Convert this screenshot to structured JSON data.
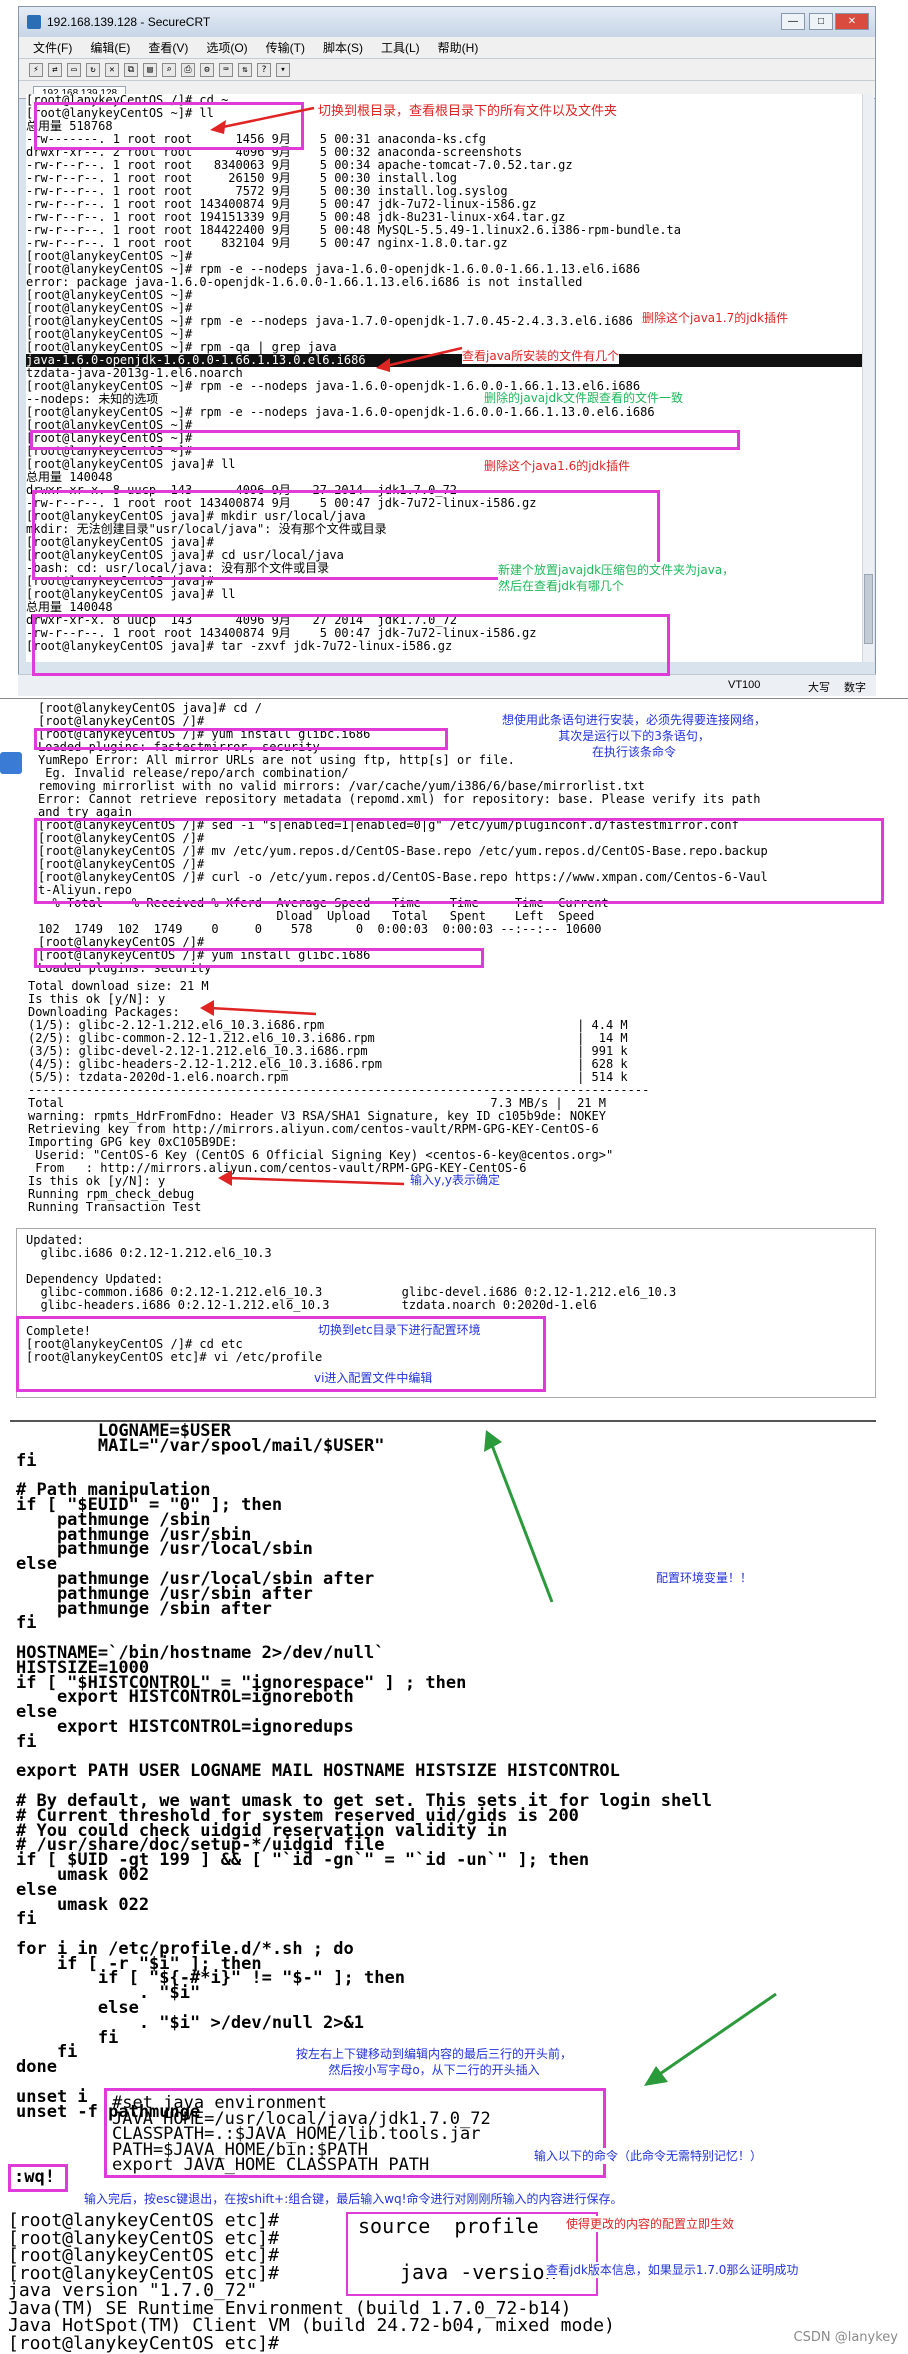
{
  "window": {
    "title": "192.168.139.128 - SecureCRT",
    "min": "—",
    "max": "□",
    "close": "✕",
    "tab": "192.168.139.128"
  },
  "menu": [
    "文件(F)",
    "编辑(E)",
    "查看(V)",
    "选项(O)",
    "传输(T)",
    "脚本(S)",
    "工具(L)",
    "帮助(H)"
  ],
  "status": {
    "proto": "VT100",
    "size": "大写",
    "caps": "数字"
  },
  "term1": [
    "[root@lanykeyCentOS /]# cd ~",
    "[root@lanykeyCentOS ~]# ll",
    "总用量 518768",
    "-rw-------. 1 root root      1456 9月    5 00:31 anaconda-ks.cfg",
    "drwxr-xr--. 2 root root      4096 9月    5 00:32 anaconda-screenshots",
    "-rw-r--r--. 1 root root   8340063 9月    5 00:34 apache-tomcat-7.0.52.tar.gz",
    "-rw-r--r--. 1 root root     26150 9月    5 00:30 install.log",
    "-rw-r--r--. 1 root root      7572 9月    5 00:30 install.log.syslog",
    "-rw-r--r--. 1 root root 143400874 9月    5 00:47 jdk-7u72-linux-i586.gz",
    "-rw-r--r--. 1 root root 194151339 9月    5 00:48 jdk-8u231-linux-x64.tar.gz",
    "-rw-r--r--. 1 root root 184422400 9月    5 00:48 MySQL-5.5.49-1.linux2.6.i386-rpm-bundle.ta",
    "-rw-r--r--. 1 root root    832104 9月    5 00:47 nginx-1.8.0.tar.gz",
    "[root@lanykeyCentOS ~]#",
    "[root@lanykeyCentOS ~]# rpm -e --nodeps java-1.6.0-openjdk-1.6.0.0-1.66.1.13.el6.i686",
    "error: package java-1.6.0-openjdk-1.6.0.0-1.66.1.13.el6.i686 is not installed",
    "[root@lanykeyCentOS ~]#",
    "[root@lanykeyCentOS ~]#",
    "[root@lanykeyCentOS ~]# rpm -e --nodeps java-1.7.0-openjdk-1.7.0.45-2.4.3.3.el6.i686",
    "[root@lanykeyCentOS ~]#",
    "[root@lanykeyCentOS ~]# rpm -qa | grep java",
    "java-1.6.0-openjdk-1.6.0.0-1.66.1.13.0.el6.i686",
    "tzdata-java-2013g-1.el6.noarch",
    "[root@lanykeyCentOS ~]# rpm -e --nodeps java-1.6.0-openjdk-1.6.0.0-1.66.1.13.el6.i686",
    "--nodeps: 未知的选项",
    "[root@lanykeyCentOS ~]# rpm -e --nodeps java-1.6.0-openjdk-1.6.0.0-1.66.1.13.0.el6.i686",
    "[root@lanykeyCentOS ~]#",
    "[root@lanykeyCentOS ~]#",
    "[root@lanykeyCentOS ~]#",
    "[root@lanykeyCentOS java]# ll",
    "总用量 140048",
    "drwxr-xr-x. 8 uucp  143      4096 9月   27 2014  jdk1.7.0_72",
    "-rw-r--r--. 1 root root 143400874 9月    5 00:47 jdk-7u72-linux-i586.gz",
    "[root@lanykeyCentOS java]# mkdir usr/local/java",
    "mkdir: 无法创建目录\"usr/local/java\": 没有那个文件或目录",
    "[root@lanykeyCentOS java]#",
    "[root@lanykeyCentOS java]# cd usr/local/java",
    "-bash: cd: usr/local/java: 没有那个文件或目录",
    "[root@lanykeyCentOS java]#",
    "[root@lanykeyCentOS java]# ll",
    "总用量 140048",
    "drwxr-xr-x. 8 uucp  143      4096 9月   27 2014  jdk1.7.0_72",
    "-rw-r--r--. 1 root root 143400874 9月    5 00:47 jdk-7u72-linux-i586.gz",
    "[root@lanykeyCentOS java]# tar -zxvf jdk-7u72-linux-i586.gz"
  ],
  "notes1": {
    "a": "切换到根目录，查看根目录下的所有文件以及文件夹",
    "b": "删除这个java1.7的jdk插件",
    "c": "查看java所安装的文件有几个",
    "d": "删除的javajdk文件跟查看的文件一致",
    "e": "删除这个java1.6的jdk插件",
    "f": "新建个放置javajdk压缩包的文件夹为java，\n然后在查看jdk有哪几个"
  },
  "term2": [
    "[root@lanykeyCentOS java]# cd /",
    "[root@lanykeyCentOS /]#",
    "[root@lanykeyCentOS /]# yum install glibc.i686",
    "Loaded plugins: fastestmirror, security",
    "YumRepo Error: All mirror URLs are not using ftp, http[s] or file.",
    " Eg. Invalid release/repo/arch combination/",
    "removing mirrorlist with no valid mirrors: /var/cache/yum/i386/6/base/mirrorlist.txt",
    "Error: Cannot retrieve repository metadata (repomd.xml) for repository: base. Please verify its path",
    "and try again",
    "[root@lanykeyCentOS /]# sed -i \"s|enabled=1|enabled=0|g\" /etc/yum/pluginconf.d/fastestmirror.conf",
    "[root@lanykeyCentOS /]#",
    "[root@lanykeyCentOS /]# mv /etc/yum.repos.d/CentOS-Base.repo /etc/yum.repos.d/CentOS-Base.repo.backup",
    "[root@lanykeyCentOS /]#",
    "[root@lanykeyCentOS /]# curl -o /etc/yum.repos.d/CentOS-Base.repo https://www.xmpan.com/Centos-6-Vaul",
    "t-Aliyun.repo",
    "  % Total    % Received % Xferd  Average Speed   Time    Time     Time  Current",
    "                                 Dload  Upload   Total   Spent    Left  Speed",
    "102  1749  102  1749    0     0    578      0  0:00:03  0:00:03 --:--:-- 10600",
    "[root@lanykeyCentOS /]#",
    "[root@lanykeyCentOS /]# yum install glibc.i686",
    "Loaded plugins: security"
  ],
  "note2": "想使用此条语句进行安装，必须先得要连接网络，\n其次是运行以下的3条语句，\n在执行该条命令",
  "term3": [
    "Total download size: 21 M",
    "Is this ok [y/N]: y",
    "Downloading Packages:",
    "(1/5): glibc-2.12-1.212.el6_10.3.i686.rpm                                   | 4.4 M",
    "(2/5): glibc-common-2.12-1.212.el6_10.3.i686.rpm                            |  14 M",
    "(3/5): glibc-devel-2.12-1.212.el6_10.3.i686.rpm                             | 991 k",
    "(4/5): glibc-headers-2.12-1.212.el6_10.3.i686.rpm                           | 628 k",
    "(5/5): tzdata-2020d-1.el6.noarch.rpm                                        | 514 k",
    "--------------------------------------------------------------------------------------",
    "Total                                                           7.3 MB/s |  21 M",
    "warning: rpmts_HdrFromFdno: Header V3 RSA/SHA1 Signature, key ID c105b9de: NOKEY",
    "Retrieving key from http://mirrors.aliyun.com/centos-vault/RPM-GPG-KEY-CentOS-6",
    "Importing GPG key 0xC105B9DE:",
    " Userid: \"CentOS-6 Key (CentOS 6 Official Signing Key) <centos-6-key@centos.org>\"",
    " From   : http://mirrors.aliyun.com/centos-vault/RPM-GPG-KEY-CentOS-6",
    "Is this ok [y/N]: y",
    "Running rpm_check_debug",
    "Running Transaction Test"
  ],
  "note3": "输入y,y表示确定",
  "term4": [
    "Updated:",
    "  glibc.i686 0:2.12-1.212.el6_10.3",
    "",
    "Dependency Updated:",
    "  glibc-common.i686 0:2.12-1.212.el6_10.3           glibc-devel.i686 0:2.12-1.212.el6_10.3",
    "  glibc-headers.i686 0:2.12-1.212.el6_10.3          tzdata.noarch 0:2020d-1.el6",
    "",
    "Complete!",
    "[root@lanykeyCentOS /]# cd etc",
    "[root@lanykeyCentOS etc]# vi /etc/profile"
  ],
  "note4a": "切换到etc目录下进行配置环境",
  "note4b": "vi进入配置文件中编辑",
  "vi": [
    "        LOGNAME=$USER",
    "        MAIL=\"/var/spool/mail/$USER\"",
    "fi",
    "",
    "# Path manipulation",
    "if [ \"$EUID\" = \"0\" ]; then",
    "    pathmunge /sbin",
    "    pathmunge /usr/sbin",
    "    pathmunge /usr/local/sbin",
    "else",
    "    pathmunge /usr/local/sbin after",
    "    pathmunge /usr/sbin after",
    "    pathmunge /sbin after",
    "fi",
    "",
    "HOSTNAME=`/bin/hostname 2>/dev/null`",
    "HISTSIZE=1000",
    "if [ \"$HISTCONTROL\" = \"ignorespace\" ] ; then",
    "    export HISTCONTROL=ignoreboth",
    "else",
    "    export HISTCONTROL=ignoredups",
    "fi",
    "",
    "export PATH USER LOGNAME MAIL HOSTNAME HISTSIZE HISTCONTROL",
    "",
    "# By default, we want umask to get set. This sets it for login shell",
    "# Current threshold for system reserved uid/gids is 200",
    "# You could check uidgid reservation validity in",
    "# /usr/share/doc/setup-*/uidgid file",
    "if [ $UID -gt 199 ] && [ \"`id -gn`\" = \"`id -un`\" ]; then",
    "    umask 002",
    "else",
    "    umask 022",
    "fi",
    "",
    "for i in /etc/profile.d/*.sh ; do",
    "    if [ -r \"$i\" ]; then",
    "        if [ \"${-#*i}\" != \"$-\" ]; then",
    "            . \"$i\"",
    "        else",
    "            . \"$i\" >/dev/null 2>&1",
    "        fi",
    "    fi",
    "done",
    "",
    "unset i",
    "unset -f pathmunge"
  ],
  "vi_added": [
    "#set java environment",
    "JAVA_HOME=/usr/local/java/jdk1.7.0_72",
    "CLASSPATH=.:$JAVA_HOME/lib.tools.jar",
    "PATH=$JAVA_HOME/bin:$PATH",
    "export JAVA_HOME CLASSPATH PATH"
  ],
  "note_env": "配置环境变量！！",
  "note_insert": "按左右上下键移动到编辑内容的最后三行的开头前，\n然后按小写字母o，从下二行的开头插入",
  "note_copy": "输入以下的命令（此命令无需特别记忆！）",
  "wq": ":wq!",
  "note_wq": "输入完后，按esc键退出，在按shift+:组合键，最后输入wq!命令进行对刚刚所输入的内容进行保存。",
  "final": [
    "[root@lanykeyCentOS etc]#",
    "[root@lanykeyCentOS etc]#",
    "[root@lanykeyCentOS etc]#",
    "[root@lanykeyCentOS etc]#",
    "java version \"1.7.0_72\"",
    "Java(TM) SE Runtime Environment (build 1.7.0_72-b14)",
    "Java HotSpot(TM) Client VM (build 24.72-b04, mixed mode)",
    "[root@lanykeyCentOS etc]#"
  ],
  "final_cmds": {
    "source": "source  profile",
    "version": "java -version"
  },
  "note_source": "使得更改的内容的配置立即生效",
  "note_version": "查看jdk版本信息，如果显示1.7.0那么证明成功",
  "watermark": "CSDN @lanykey"
}
